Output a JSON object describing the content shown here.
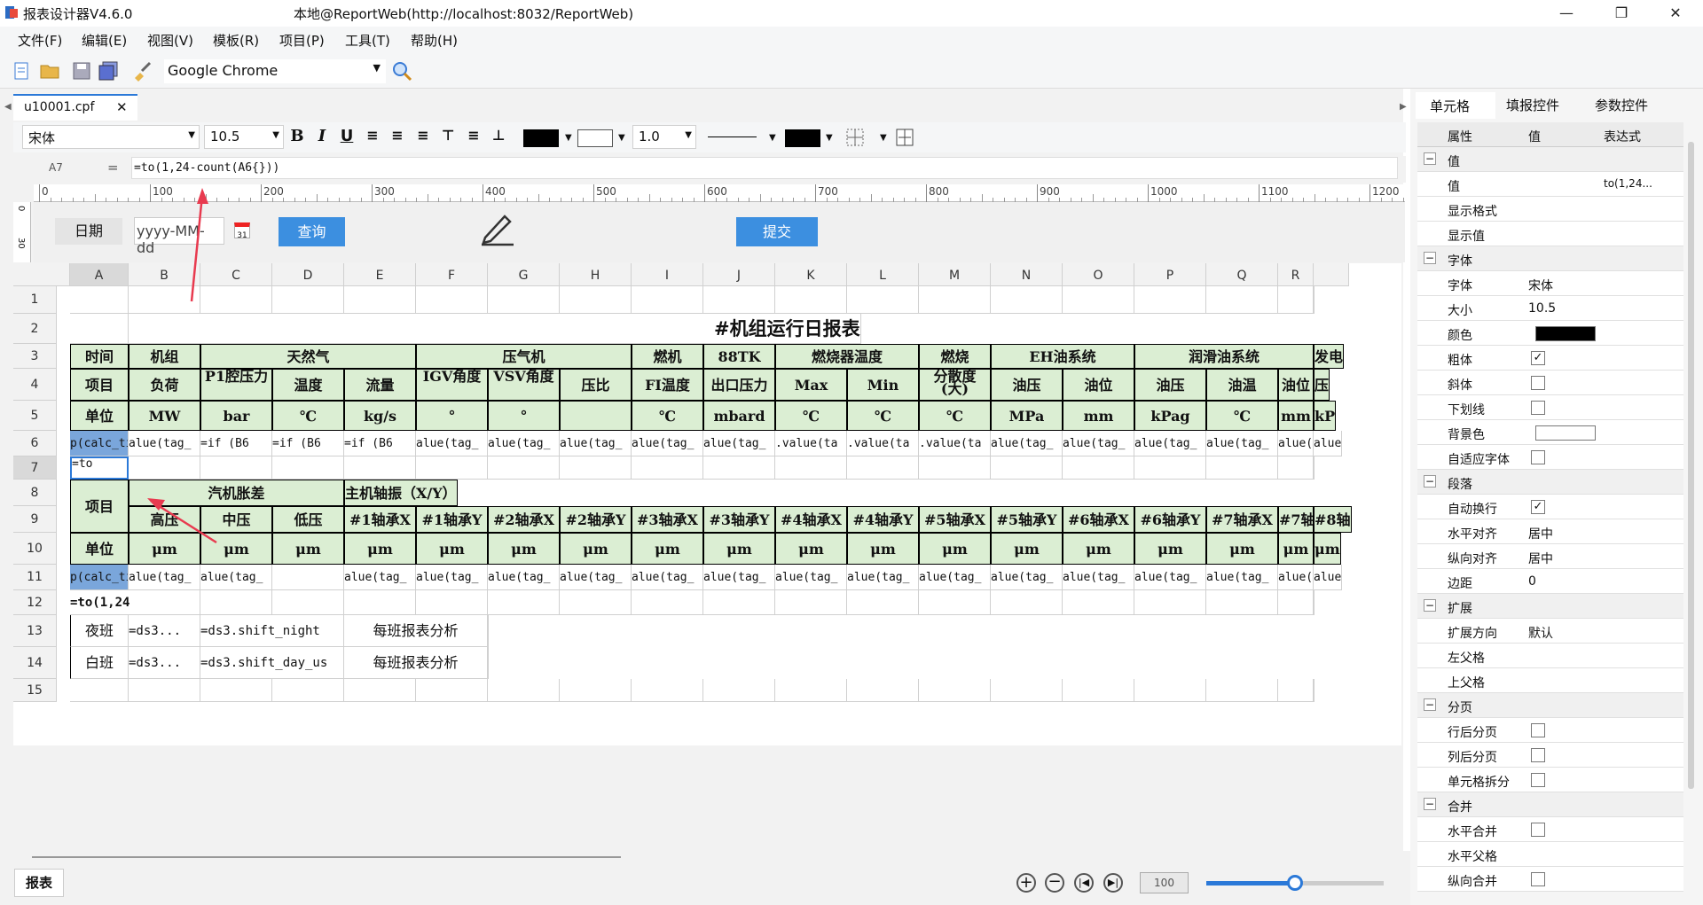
{
  "title": {
    "app": "报表设计器V4.6.0",
    "connection": "本地@ReportWeb(http://localhost:8032/ReportWeb)"
  },
  "menu": [
    "文件(F)",
    "编辑(E)",
    "视图(V)",
    "模板(R)",
    "项目(P)",
    "工具(T)",
    "帮助(H)"
  ],
  "toolbar": {
    "browser": "Google Chrome"
  },
  "doc_tab": "u10001.cpf",
  "format": {
    "font": "宋体",
    "size": "10.5",
    "line_width": "1.0"
  },
  "formula": {
    "cell": "A7",
    "eq": "=",
    "value": "=to(1,24-count(A6{}))"
  },
  "ruler_ticks": [
    "0",
    "100",
    "200",
    "300",
    "400",
    "500",
    "600",
    "700",
    "800",
    "900",
    "1000",
    "1100",
    "1200"
  ],
  "vruler": [
    "0",
    "30"
  ],
  "form": {
    "date_label": "日期",
    "date_placeholder": "yyyy-MM-dd",
    "query": "查询",
    "submit": "提交",
    "cal": "31"
  },
  "columns": [
    "A",
    "B",
    "C",
    "D",
    "E",
    "F",
    "G",
    "H",
    "I",
    "J",
    "K",
    "L",
    "M",
    "N",
    "O",
    "P",
    "Q",
    "R"
  ],
  "rows": [
    "1",
    "2",
    "3",
    "4",
    "5",
    "6",
    "7",
    "8",
    "9",
    "10",
    "11",
    "12",
    "13",
    "14",
    "15"
  ],
  "report": {
    "title": "#机组运行日报表",
    "r3": {
      "time": "时间",
      "unit_group": "机组",
      "gas": "天然气",
      "compressor": "压气机",
      "turbine": "燃机",
      "tk": "88TK",
      "burner_temp": "燃烧器温度",
      "burn": "燃烧",
      "eh": "EH油系统",
      "lube": "润滑油系统",
      "gen": "发电"
    },
    "r4": [
      "项目",
      "负荷",
      "P1腔压力",
      "温度",
      "流量",
      "IGV角度",
      "VSV角度",
      "压比",
      "FI温度",
      "出口压力",
      "Max",
      "Min",
      "分散度(大)",
      "油压",
      "油位",
      "油压",
      "油温",
      "油位",
      "压"
    ],
    "r5": [
      "单位",
      "MW",
      "bar",
      "℃",
      "kg/s",
      "°",
      "°",
      "",
      "℃",
      "mbard",
      "℃",
      "℃",
      "℃",
      "MPa",
      "mm",
      "kPag",
      "℃",
      "mm",
      "kP"
    ],
    "r6": [
      "p(calc_ti",
      "alue(tag_",
      "=if (B6",
      "=if (B6",
      "=if (B6",
      "alue(tag_",
      "alue(tag_",
      "alue(tag_",
      "alue(tag_",
      "alue(tag_",
      ".value(ta",
      ".value(ta",
      ".value(ta",
      "alue(tag_",
      "alue(tag_",
      "alue(tag_",
      "alue(tag_",
      "alue(tag_",
      "alue"
    ],
    "a7": "=to",
    "r8": {
      "item": "项目",
      "steam": "汽机胀差",
      "vib": "主机轴振（X/Y）"
    },
    "r9": [
      "高压",
      "中压",
      "低压",
      "#1轴承X",
      "#1轴承Y",
      "#2轴承X",
      "#2轴承Y",
      "#3轴承X",
      "#3轴承Y",
      "#4轴承X",
      "#4轴承Y",
      "#5轴承X",
      "#5轴承Y",
      "#6轴承X",
      "#6轴承Y",
      "#7轴承X",
      "#7轴承Y",
      "#8轴"
    ],
    "r10": [
      "单位",
      "μm",
      "μm",
      "μm",
      "μm",
      "μm",
      "μm",
      "μm",
      "μm",
      "μm",
      "μm",
      "μm",
      "μm",
      "μm",
      "μm",
      "μm",
      "μm",
      "μm",
      "μm"
    ],
    "r11": [
      "p(calc_ti",
      "alue(tag_",
      "alue(tag_",
      "",
      "alue(tag_",
      "alue(tag_",
      "alue(tag_",
      "alue(tag_",
      "alue(tag_",
      "alue(tag_",
      "alue(tag_",
      "alue(tag_",
      "alue(tag_",
      "alue(tag_",
      "alue(tag_",
      "alue(tag_",
      "alue(tag_",
      "alue(tag_",
      "alue"
    ],
    "a12": "=to(1,24",
    "r13": {
      "label": "夜班",
      "b": "=ds3...",
      "c": "=ds3.shift_night",
      "e": "每班报表分析"
    },
    "r14": {
      "label": "白班",
      "b": "=ds3...",
      "c": "=ds3.shift_day_us",
      "e": "每班报表分析"
    }
  },
  "sheet_tab": "报表",
  "zoom": {
    "value": "100",
    "fraction": 0.5
  },
  "right_tabs": [
    "单元格",
    "填报控件",
    "参数控件"
  ],
  "prop_headers": [
    "属性",
    "值",
    "表达式"
  ],
  "props": [
    {
      "type": "group",
      "name": "值"
    },
    {
      "type": "row",
      "name": "值",
      "value": "",
      "expr": "to(1,24..."
    },
    {
      "type": "row",
      "name": "显示格式",
      "value": ""
    },
    {
      "type": "row",
      "name": "显示值",
      "value": ""
    },
    {
      "type": "group",
      "name": "字体"
    },
    {
      "type": "row",
      "name": "字体",
      "value": "宋体"
    },
    {
      "type": "row",
      "name": "大小",
      "value": "10.5"
    },
    {
      "type": "color",
      "name": "颜色",
      "color": "#000000"
    },
    {
      "type": "check",
      "name": "粗体",
      "checked": true
    },
    {
      "type": "check",
      "name": "斜体",
      "checked": false
    },
    {
      "type": "check",
      "name": "下划线",
      "checked": false
    },
    {
      "type": "color",
      "name": "背景色",
      "color": "#ffffff"
    },
    {
      "type": "check",
      "name": "自适应字体",
      "checked": false
    },
    {
      "type": "group",
      "name": "段落"
    },
    {
      "type": "check",
      "name": "自动换行",
      "checked": true
    },
    {
      "type": "row",
      "name": "水平对齐",
      "value": "居中"
    },
    {
      "type": "row",
      "name": "纵向对齐",
      "value": "居中"
    },
    {
      "type": "row",
      "name": "边距",
      "value": "0"
    },
    {
      "type": "group",
      "name": "扩展"
    },
    {
      "type": "row",
      "name": "扩展方向",
      "value": "默认"
    },
    {
      "type": "row",
      "name": "左父格",
      "value": ""
    },
    {
      "type": "row",
      "name": "上父格",
      "value": ""
    },
    {
      "type": "group",
      "name": "分页"
    },
    {
      "type": "check",
      "name": "行后分页",
      "checked": false
    },
    {
      "type": "check",
      "name": "列后分页",
      "checked": false
    },
    {
      "type": "check",
      "name": "单元格拆分",
      "checked": false
    },
    {
      "type": "group",
      "name": "合并"
    },
    {
      "type": "check",
      "name": "水平合并",
      "checked": false
    },
    {
      "type": "row",
      "name": "水平父格",
      "value": ""
    },
    {
      "type": "check",
      "name": "纵向合并",
      "checked": false
    }
  ]
}
